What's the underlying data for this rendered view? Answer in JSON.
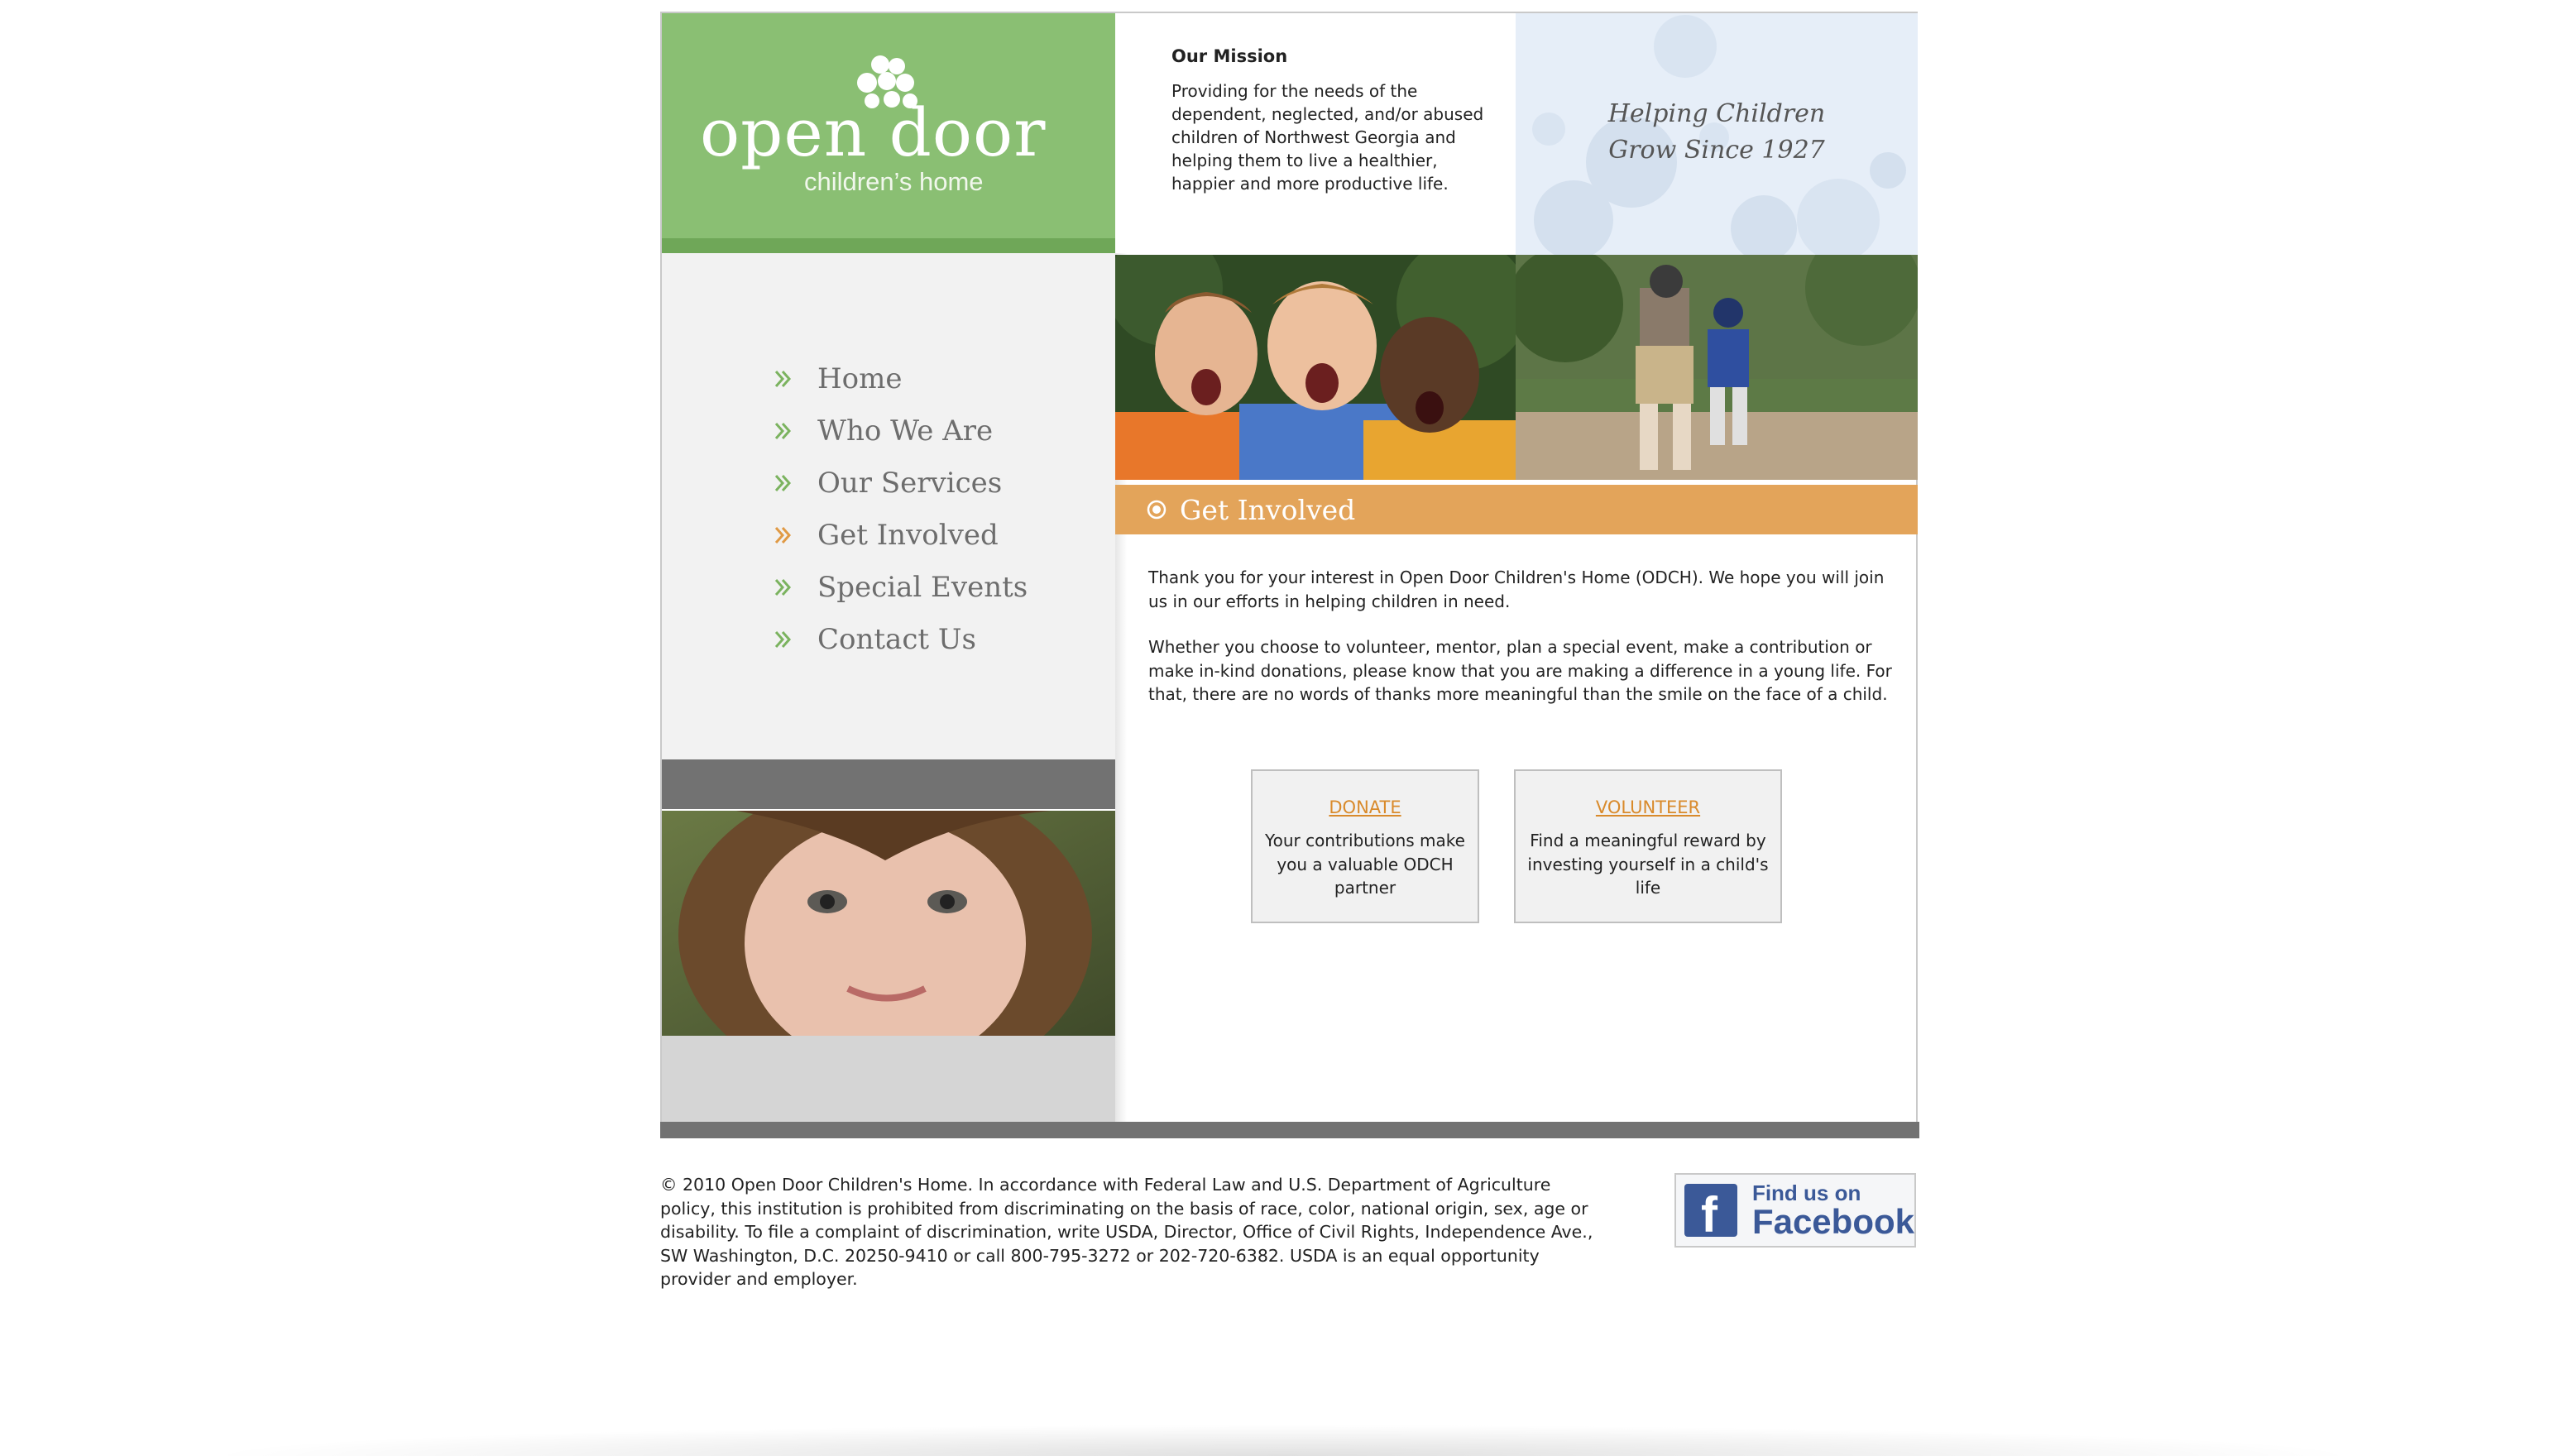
{
  "logo": {
    "name": "open door",
    "subtitle": "children’s home"
  },
  "nav": {
    "items": [
      {
        "label": "Home",
        "icon": "double-chevron-icon",
        "color": "#7bb35f"
      },
      {
        "label": "Who We Are",
        "icon": "double-chevron-icon",
        "color": "#7bb35f"
      },
      {
        "label": "Our Services",
        "icon": "double-chevron-icon",
        "color": "#7bb35f"
      },
      {
        "label": "Get Involved",
        "icon": "double-chevron-icon",
        "color": "#e09a45"
      },
      {
        "label": "Special Events",
        "icon": "double-chevron-icon",
        "color": "#7bb35f"
      },
      {
        "label": "Contact Us",
        "icon": "double-chevron-icon",
        "color": "#7bb35f"
      }
    ]
  },
  "mission": {
    "heading": "Our Mission",
    "text": "Providing for the needs of the dependent, neglected, and/or abused children of Northwest Georgia and helping them to live a healthier, happier and more productive life."
  },
  "tagline": {
    "line1": "Helping Children",
    "line2": "Grow Since 1927"
  },
  "section": {
    "title": "Get Involved",
    "paragraph1": "Thank you for your interest in Open Door Children's Home (ODCH). We hope you will join us in our efforts in helping children in need.",
    "paragraph2": "Whether you choose to volunteer, mentor, plan a special event, make a contribution or make in-kind donations, please know that you are making a difference in a young life. For that, there are no words of thanks more meaningful than the smile on the face of a child."
  },
  "cards": {
    "donate": {
      "link": "DONATE",
      "desc": "Your contributions make you a valuable ODCH partner"
    },
    "volunteer": {
      "link": "VOLUNTEER",
      "desc": "Find a meaningful reward by investing yourself in a child's life"
    }
  },
  "footer": {
    "text": "© 2010 Open Door Children's Home. In accordance with Federal Law and U.S. Department of Agriculture policy, this institution is prohibited from discriminating on the basis of race, color, national origin, sex, age or disability. To file a complaint of discrimination, write USDA, Director, Office of Civil Rights, Independence Ave., SW Washington, D.C. 20250-9410 or call 800-795-3272 or 202-720-6382. USDA is an equal opportunity provider and employer."
  },
  "facebook": {
    "line1": "Find us on",
    "line2": "Facebook",
    "icon": "facebook-icon",
    "color": "#3b5998"
  },
  "colors": {
    "logo_green": "#8abf73",
    "accent_orange": "#e3a45a",
    "link_orange": "#d98a2b",
    "nav_gray": "#727272"
  }
}
